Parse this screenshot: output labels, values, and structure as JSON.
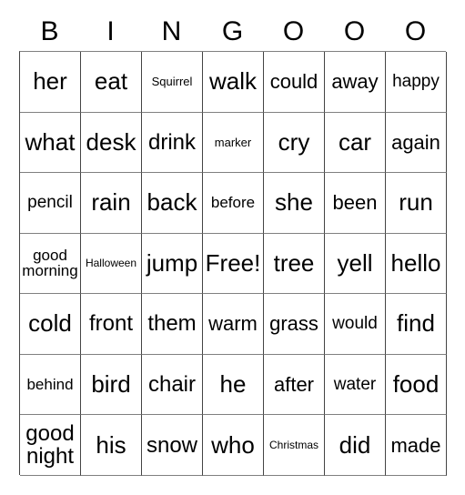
{
  "card": {
    "title_letters": [
      "B",
      "I",
      "N",
      "G",
      "O",
      "O",
      "O"
    ],
    "columns": 7,
    "rows": 7,
    "free_space_label": "Free!",
    "grid": [
      [
        {
          "text": "her",
          "size": "fs-xxl"
        },
        {
          "text": "eat",
          "size": "fs-xxl"
        },
        {
          "text": "Squirrel",
          "size": "fs-s"
        },
        {
          "text": "walk",
          "size": "fs-xxl"
        },
        {
          "text": "could",
          "size": "fs-l"
        },
        {
          "text": "away",
          "size": "fs-l"
        },
        {
          "text": "happy",
          "size": "fs-ml"
        }
      ],
      [
        {
          "text": "what",
          "size": "fs-xxl"
        },
        {
          "text": "desk",
          "size": "fs-xxl"
        },
        {
          "text": "drink",
          "size": "fs-xl"
        },
        {
          "text": "marker",
          "size": "fs-s"
        },
        {
          "text": "cry",
          "size": "fs-xxl"
        },
        {
          "text": "car",
          "size": "fs-xxl"
        },
        {
          "text": "again",
          "size": "fs-l"
        }
      ],
      [
        {
          "text": "pencil",
          "size": "fs-ml"
        },
        {
          "text": "rain",
          "size": "fs-xxl"
        },
        {
          "text": "back",
          "size": "fs-xxl"
        },
        {
          "text": "before",
          "size": "fs-m"
        },
        {
          "text": "she",
          "size": "fs-xxl"
        },
        {
          "text": "been",
          "size": "fs-l"
        },
        {
          "text": "run",
          "size": "fs-xxl"
        }
      ],
      [
        {
          "text": "good morning",
          "size": "fs-m"
        },
        {
          "text": "Halloween",
          "size": "fs-xs"
        },
        {
          "text": "jump",
          "size": "fs-xxl"
        },
        {
          "text": "Free!",
          "size": "fs-xxl"
        },
        {
          "text": "tree",
          "size": "fs-xxl"
        },
        {
          "text": "yell",
          "size": "fs-xxl"
        },
        {
          "text": "hello",
          "size": "fs-xxl"
        }
      ],
      [
        {
          "text": "cold",
          "size": "fs-xxl"
        },
        {
          "text": "front",
          "size": "fs-xl"
        },
        {
          "text": "them",
          "size": "fs-xl"
        },
        {
          "text": "warm",
          "size": "fs-l"
        },
        {
          "text": "grass",
          "size": "fs-l"
        },
        {
          "text": "would",
          "size": "fs-ml"
        },
        {
          "text": "find",
          "size": "fs-xxl"
        }
      ],
      [
        {
          "text": "behind",
          "size": "fs-m"
        },
        {
          "text": "bird",
          "size": "fs-xxl"
        },
        {
          "text": "chair",
          "size": "fs-xl"
        },
        {
          "text": "he",
          "size": "fs-xxl"
        },
        {
          "text": "after",
          "size": "fs-l"
        },
        {
          "text": "water",
          "size": "fs-ml"
        },
        {
          "text": "food",
          "size": "fs-xxl"
        }
      ],
      [
        {
          "text": "good night",
          "size": "fs-xl"
        },
        {
          "text": "his",
          "size": "fs-xxl"
        },
        {
          "text": "snow",
          "size": "fs-xl"
        },
        {
          "text": "who",
          "size": "fs-xxl"
        },
        {
          "text": "Christmas",
          "size": "fs-xs"
        },
        {
          "text": "did",
          "size": "fs-xxl"
        },
        {
          "text": "made",
          "size": "fs-l"
        }
      ]
    ]
  },
  "colors": {
    "background": "#ffffff",
    "text": "#000000",
    "grid_line_vertical": "#444444",
    "grid_line_horizontal": "#808080"
  }
}
